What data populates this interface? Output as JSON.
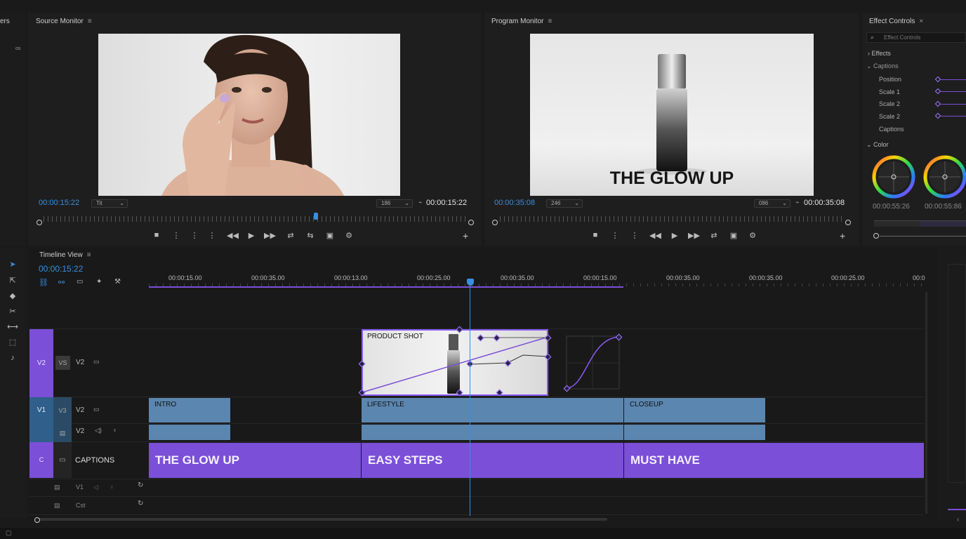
{
  "left_sidebar": {
    "title_fragment": "ers",
    "label": "os"
  },
  "source_monitor": {
    "title": "Source Monitor",
    "timecode_left": "00:00:15:22",
    "dropdown_left": "Tit",
    "dropdown_right": "186",
    "timecode_right": "00:00:15:22",
    "playhead_fraction": 0.64
  },
  "program_monitor": {
    "title": "Program Monitor",
    "timecode_left": "00:00:35:08",
    "dropdown_left": "246",
    "dropdown_right": "086",
    "timecode_right": "00:00:35:08",
    "overlay_caption": "THE GLOW UP"
  },
  "effect_controls": {
    "title": "Effect Controls",
    "search_placeholder": "Effect Controls",
    "sections": {
      "effects": "Effects",
      "captions": "Captions",
      "color": "Color"
    },
    "params": [
      "Position",
      "Scale 1",
      "Scale 2",
      "Scale 2",
      "Captions"
    ],
    "wheel_timecode_1": "00:00:55:26",
    "wheel_timecode_2": "00:00:55:86"
  },
  "timeline": {
    "title": "Timeline View",
    "timecode": "00:00:15:22",
    "ruler_ticks": [
      "00:00:15.00",
      "00:00:35.00",
      "00:00:13.00",
      "00:00:25.00",
      "00:00:35.00",
      "00:00:15.00",
      "00:00:35.00",
      "00:00:35.00",
      "00:00:25.00",
      "00:0"
    ],
    "tracks": {
      "v2": {
        "tag": "V2",
        "toggle": "VS",
        "name": "V2"
      },
      "v1": {
        "tag": "V1",
        "toggle": "V3",
        "name": "V2"
      },
      "a1": {
        "name": "V2"
      },
      "captions": {
        "tag": "C",
        "name": "CAPTIONS"
      },
      "sub1": {
        "name": "V1"
      },
      "sub2": {
        "name": "Cst"
      }
    },
    "clips": {
      "product": "PRODUCT SHOT",
      "intro": "INTRO",
      "lifestyle": "LIFESTYLE",
      "closeup": "CLOSEUP",
      "cap1": "THE GLOW UP",
      "cap2": "EASY STEPS",
      "cap3": "MUST HAVE"
    }
  },
  "colors": {
    "accent": "#7b4fd8",
    "timecode": "#3b8ede",
    "clip": "#5b86b0"
  }
}
